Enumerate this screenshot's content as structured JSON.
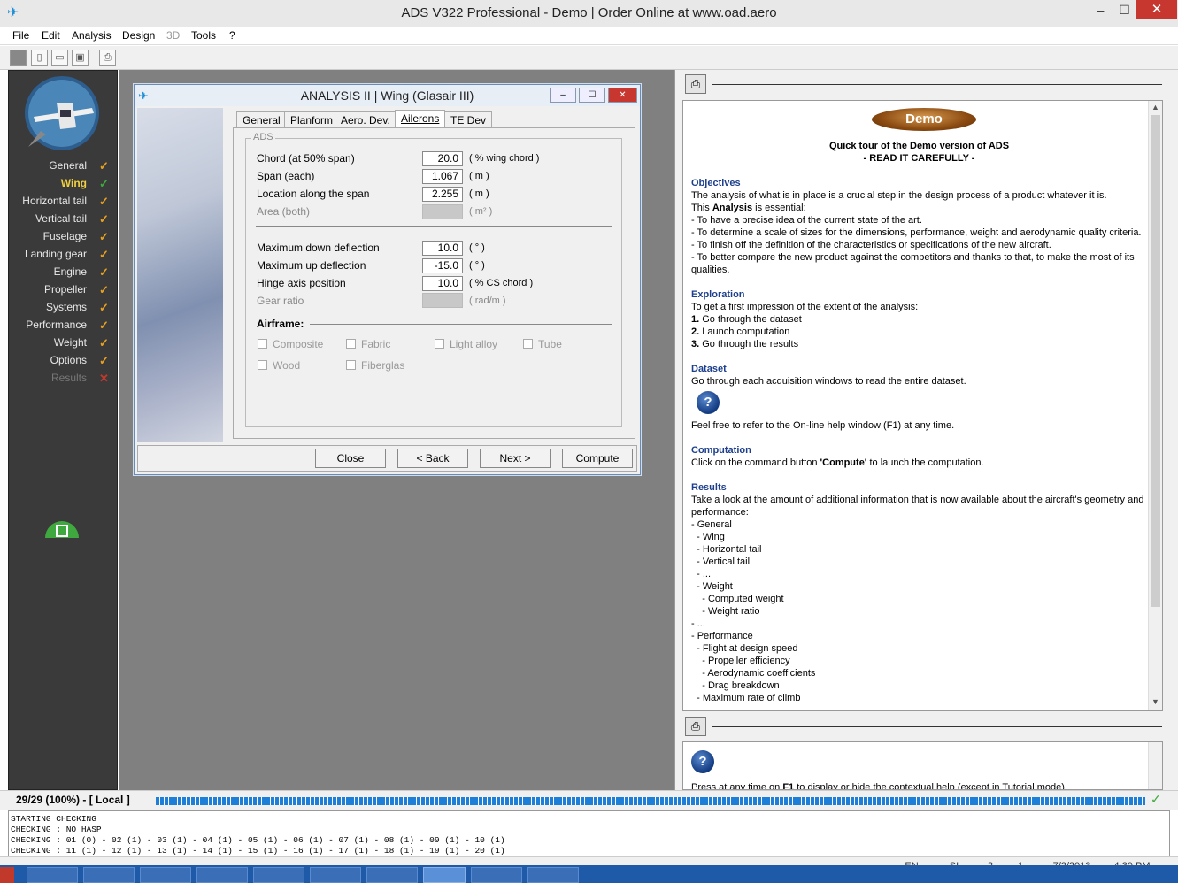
{
  "window": {
    "title": "ADS V322 Professional - Demo  |  Order Online at www.oad.aero",
    "min_glyph": "–",
    "max_glyph": "☐",
    "close_glyph": "✕"
  },
  "menu": [
    "File",
    "Edit",
    "Analysis",
    "Design",
    "3D",
    "Tools",
    "?"
  ],
  "sidebar": {
    "items": [
      {
        "label": "General",
        "status": "✓",
        "state": "done"
      },
      {
        "label": "Wing",
        "status": "✓",
        "state": "active"
      },
      {
        "label": "Horizontal tail",
        "status": "✓",
        "state": "done"
      },
      {
        "label": "Vertical tail",
        "status": "✓",
        "state": "done"
      },
      {
        "label": "Fuselage",
        "status": "✓",
        "state": "done"
      },
      {
        "label": "Landing gear",
        "status": "✓",
        "state": "done"
      },
      {
        "label": "Engine",
        "status": "✓",
        "state": "done"
      },
      {
        "label": "Propeller",
        "status": "✓",
        "state": "done"
      },
      {
        "label": "Systems",
        "status": "✓",
        "state": "done"
      },
      {
        "label": "Performance",
        "status": "✓",
        "state": "done"
      },
      {
        "label": "Weight",
        "status": "✓",
        "state": "done"
      },
      {
        "label": "Options",
        "status": "✓",
        "state": "done"
      },
      {
        "label": "Results",
        "status": "✕",
        "state": "disabled"
      }
    ]
  },
  "dialog": {
    "title": "ANALYSIS II | Wing (Glasair III)",
    "tabs": [
      "General",
      "Planform",
      "Aero. Dev.",
      "Ailerons",
      "TE Dev"
    ],
    "active_tab": "Ailerons",
    "group_label": "ADS",
    "fields": [
      {
        "label": "Chord (at 50% span)",
        "value": "20.0",
        "unit": "( % wing chord )",
        "enabled": true
      },
      {
        "label": "Span (each)",
        "value": "1.067",
        "unit": "( m )",
        "enabled": true
      },
      {
        "label": "Location along the span",
        "value": "2.255",
        "unit": "( m )",
        "enabled": true
      },
      {
        "label": "Area (both)",
        "value": "",
        "unit": "( m² )",
        "enabled": false
      },
      {
        "label": "Maximum down deflection",
        "value": "10.0",
        "unit": "( ° )",
        "enabled": true
      },
      {
        "label": "Maximum up deflection",
        "value": "-15.0",
        "unit": "( ° )",
        "enabled": true
      },
      {
        "label": "Hinge axis position",
        "value": "10.0",
        "unit": "( % CS chord )",
        "enabled": true
      },
      {
        "label": "Gear ratio",
        "value": "",
        "unit": "( rad/m )",
        "enabled": false
      }
    ],
    "airframe_label": "Airframe:",
    "airframe_options": [
      "Composite",
      "Fabric",
      "Light alloy",
      "Tube",
      "Wood",
      "Fiberglas"
    ],
    "buttons": [
      "Close",
      "< Back",
      "Next >",
      "Compute"
    ]
  },
  "help": {
    "badge": "Demo",
    "intro_title": "Quick tour of the Demo version of ADS",
    "intro_sub": "- READ IT CAREFULLY -",
    "sections": {
      "objectives": {
        "heading": "Objectives",
        "lines": [
          "The analysis of what is in place is a crucial step in the design process of a product whatever it is.",
          "This Analysis is essential:",
          "- To have a precise idea of the current state of the art.",
          "- To determine a scale of sizes for the dimensions, performance, weight and aerodynamic quality criteria.",
          "- To finish off the definition of the characteristics or specifications of the new aircraft.",
          "- To better compare the new product against the competitors and thanks to that, to make the most of its qualities."
        ]
      },
      "exploration": {
        "heading": "Exploration",
        "intro": "To get a first impression of the extent of the analysis:",
        "steps": [
          {
            "n": "1.",
            "text": "Go through the dataset"
          },
          {
            "n": "2.",
            "text": "Launch computation"
          },
          {
            "n": "3.",
            "text": "Go through the results"
          }
        ]
      },
      "dataset": {
        "heading": "Dataset",
        "line": "Go through each acquisition windows to read the entire dataset.",
        "help_line": "Feel free to refer to the On-line help window (F1) at any time."
      },
      "computation": {
        "heading": "Computation",
        "line_pre": "Click on the command button ",
        "line_bold": "'Compute'",
        "line_post": " to launch the computation."
      },
      "results": {
        "heading": "Results",
        "line": "Take a look at the amount of additional information that is now available about the aircraft's geometry and performance:",
        "items": [
          "- General",
          "  - Wing",
          "  - Horizontal tail",
          "  - Vertical tail",
          "  - ...",
          "  - Weight",
          "    - Computed weight",
          "    - Weight ratio",
          "- ...",
          "- Performance",
          "  - Flight at design speed",
          "    - Propeller efficiency",
          "    - Aerodynamic coefficients",
          "    - Drag breakdown",
          "  - Maximum rate of climb"
        ]
      }
    },
    "tip": "Press at any time on F1 to display or hide the contextual help (except in Tutorial mode)."
  },
  "status": {
    "progress_label": "29/29  (100%) - [ Local ]",
    "progress_fraction": 1.0
  },
  "log": [
    "STARTING CHECKING",
    "CHECKING : NO HASP",
    "CHECKING : 01 (0) - 02 (1) - 03 (1) - 04 (1) - 05 (1) - 06 (1) - 07 (1) - 08 (1) - 09 (1) - 10 (1)",
    "CHECKING : 11 (1) - 12 (1) - 13 (1) - 14 (1) - 15 (1) - 16 (1) - 17 (1) - 18 (1) - 19 (1) - 20 (1)"
  ],
  "bottom": {
    "lang": "EN",
    "units": "SI",
    "v1": "2",
    "v2": "1",
    "date": "7/2/2013",
    "time": "4:30 PM"
  },
  "colors": {
    "accent": "#1e7fd8",
    "check": "#e8a020",
    "active_check": "#3fa83f",
    "error": "#c0392b",
    "help_heading": "#1d3f8c"
  }
}
